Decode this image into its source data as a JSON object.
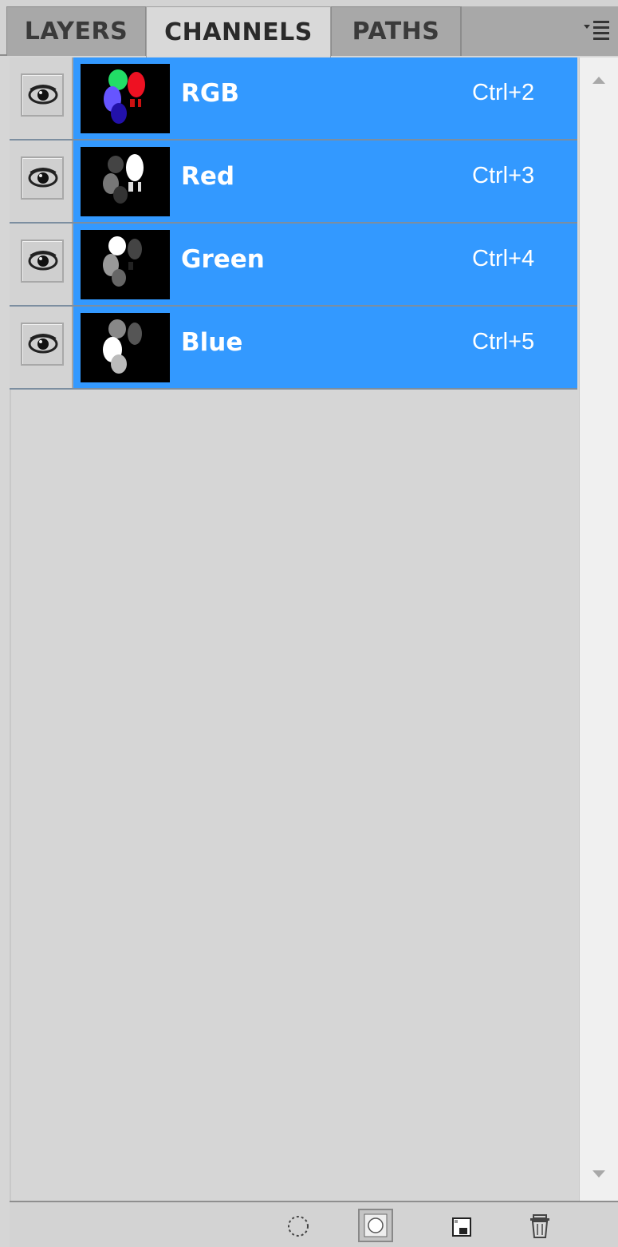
{
  "tabs": [
    {
      "label": "LAYERS",
      "active": false
    },
    {
      "label": "CHANNELS",
      "active": true
    },
    {
      "label": "PATHS",
      "active": false
    }
  ],
  "panel_menu_icon": "panel-menu-icon",
  "channels": [
    {
      "name": "RGB",
      "shortcut": "Ctrl+2",
      "visible": true,
      "selected": true,
      "thumbnail": "rgb-composite"
    },
    {
      "name": "Red",
      "shortcut": "Ctrl+3",
      "visible": true,
      "selected": true,
      "thumbnail": "red-channel"
    },
    {
      "name": "Green",
      "shortcut": "Ctrl+4",
      "visible": true,
      "selected": true,
      "thumbnail": "green-channel"
    },
    {
      "name": "Blue",
      "shortcut": "Ctrl+5",
      "visible": true,
      "selected": true,
      "thumbnail": "blue-channel"
    }
  ],
  "colors": {
    "selection": "#3399ff",
    "panel_bg": "#d6d6d6",
    "tab_inactive": "#a8a8a8",
    "tab_active": "#d9d9d9"
  },
  "footer_buttons": [
    {
      "icon": "load-channel-as-selection-icon"
    },
    {
      "icon": "save-selection-as-channel-icon"
    },
    {
      "icon": "new-channel-icon"
    },
    {
      "icon": "delete-channel-icon"
    }
  ]
}
